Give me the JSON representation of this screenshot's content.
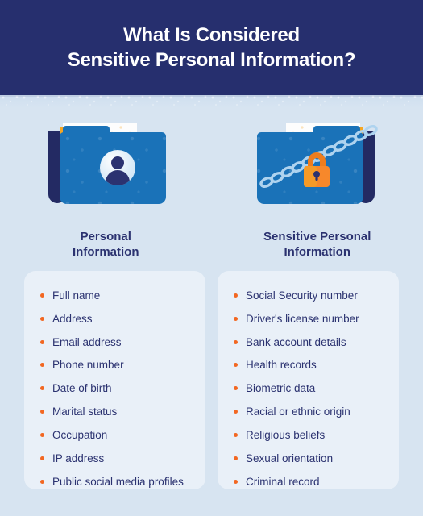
{
  "header": {
    "title_line1": "What Is Considered",
    "title_line2": "Sensitive Personal Information?",
    "background_color": "#262f6e",
    "text_color": "#ffffff"
  },
  "theme": {
    "page_background": "#d7e4f1",
    "card_background": "#e9f0f8",
    "navy": "#2b3270",
    "folder_blue": "#1a72b8",
    "accent_orange": "#f26722",
    "paper_orange": "#f5a623",
    "chain_blue": "#aed3ef"
  },
  "columns": [
    {
      "key": "personal",
      "illustration": "folder-with-person-icon",
      "heading_line1": "Personal",
      "heading_line2": "Information",
      "items": [
        "Full name",
        "Address",
        "Email address",
        "Phone number",
        "Date of birth",
        "Marital status",
        "Occupation",
        "IP address",
        "Public social media profiles"
      ]
    },
    {
      "key": "sensitive",
      "illustration": "folder-chained-with-padlock",
      "heading_line1": "Sensitive Personal",
      "heading_line2": "Information",
      "items": [
        "Social Security number",
        "Driver's license number",
        "Bank account details",
        "Health records",
        "Biometric data",
        "Racial or ethnic origin",
        "Religious beliefs",
        "Sexual orientation",
        "Criminal record"
      ]
    }
  ]
}
